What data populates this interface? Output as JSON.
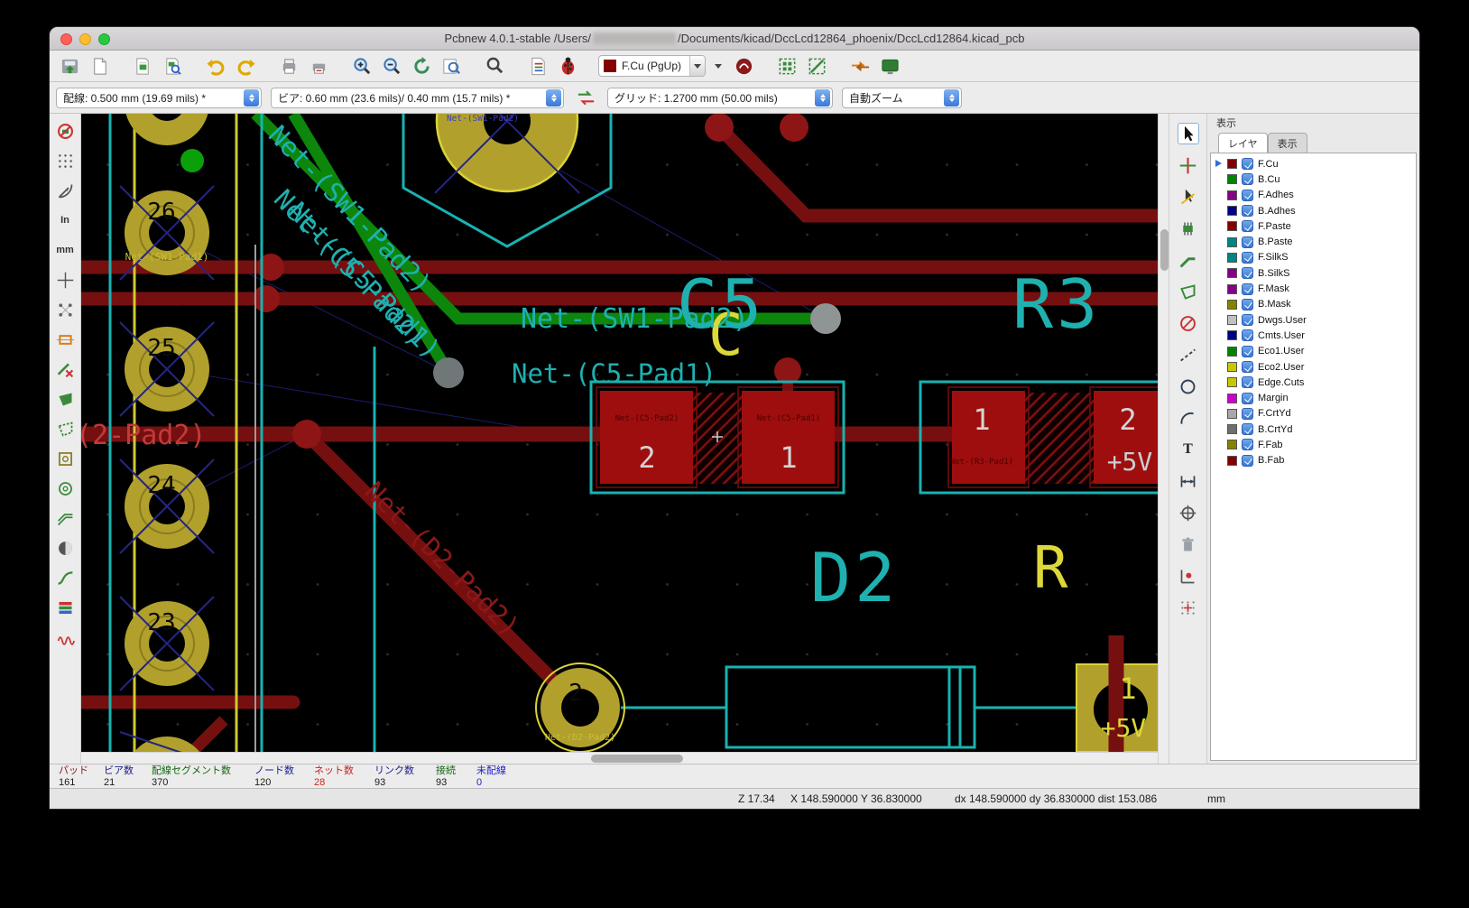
{
  "window": {
    "title_prefix": "Pcbnew 4.0.1-stable /Users/",
    "title_suffix": "/Documents/kicad/DccLcd12864_phoenix/DccLcd12864.kicad_pcb"
  },
  "colors": {
    "copper_front": "#840000",
    "copper_back": "#008400",
    "silkscreen": "#19b2b2",
    "pad_yellow": "#b1a12c",
    "edge_cuts": "#cfca30",
    "accent_blue": "#3b77d8"
  },
  "toolbar_top": {
    "icons": [
      "save-icon",
      "page-settings-icon",
      "footprint-editor-icon",
      "footprint-browser-icon",
      "undo-icon",
      "redo-icon",
      "print-icon",
      "plot-icon",
      "zoom-in-icon",
      "zoom-out-icon",
      "zoom-redraw-icon",
      "zoom-fit-icon",
      "find-icon",
      "netlist-icon",
      "drc-icon",
      "microwave-tools-icon",
      "footprint-mode-icon",
      "track-mode-icon",
      "freeroute-icon",
      "scripting-console-icon"
    ],
    "layer_combo": {
      "value": "F.Cu (PgUp)",
      "color": "#840000"
    }
  },
  "toolbar_params": {
    "track": "配線: 0.500 mm (19.69 mils) *",
    "via": "ビア: 0.60 mm (23.6 mils)/ 0.40 mm (15.7 mils) *",
    "grid": "グリッド: 1.2700 mm (50.00 mils)",
    "zoom": "自動ズーム"
  },
  "toolbar_left": {
    "icons": [
      "drc-toggle-icon",
      "grid-toggle-icon",
      "polar-coords-icon",
      "units-inches-icon",
      "units-mm-icon",
      "cursor-shape-icon",
      "ratsnest-toggle-icon",
      "module-ratsnest-icon",
      "track-autodelete-icon",
      "zone-fill-icon",
      "zone-outline-icon",
      "pad-sketch-icon",
      "via-sketch-icon",
      "track-sketch-icon",
      "high-contrast-icon",
      "route-mode-icon",
      "layers-manager-toggle-icon",
      "microwave-toolbar-icon"
    ],
    "units_in": "In",
    "units_mm": "mm"
  },
  "toolbar_right": {
    "icons": [
      "pointer-icon",
      "highlight-net-icon",
      "local-ratsnest-icon",
      "add-footprint-icon",
      "route-track-icon",
      "add-zone-icon",
      "add-keepout-icon",
      "add-line-icon",
      "add-circle-icon",
      "add-arc-icon",
      "add-text-icon",
      "add-dimension-icon",
      "add-target-icon",
      "delete-icon",
      "drill-origin-icon",
      "grid-origin-icon"
    ],
    "text_tool": "T"
  },
  "layers_panel": {
    "header": "表示",
    "tab_layers": "レイヤ",
    "tab_render": "表示",
    "layers": [
      {
        "name": "F.Cu",
        "color": "#840000",
        "checked": true,
        "active": true
      },
      {
        "name": "B.Cu",
        "color": "#008400",
        "checked": true
      },
      {
        "name": "F.Adhes",
        "color": "#840084",
        "checked": true
      },
      {
        "name": "B.Adhes",
        "color": "#000084",
        "checked": true
      },
      {
        "name": "F.Paste",
        "color": "#840000",
        "checked": true
      },
      {
        "name": "B.Paste",
        "color": "#008484",
        "checked": true
      },
      {
        "name": "F.SilkS",
        "color": "#008484",
        "checked": true
      },
      {
        "name": "B.SilkS",
        "color": "#840084",
        "checked": true
      },
      {
        "name": "F.Mask",
        "color": "#840084",
        "checked": true
      },
      {
        "name": "B.Mask",
        "color": "#848400",
        "checked": true
      },
      {
        "name": "Dwgs.User",
        "color": "#c0c0c0",
        "checked": true
      },
      {
        "name": "Cmts.User",
        "color": "#000084",
        "checked": true
      },
      {
        "name": "Eco1.User",
        "color": "#008400",
        "checked": true
      },
      {
        "name": "Eco2.User",
        "color": "#c8c800",
        "checked": true
      },
      {
        "name": "Edge.Cuts",
        "color": "#c8c800",
        "checked": true
      },
      {
        "name": "Margin",
        "color": "#cc00cc",
        "checked": true
      },
      {
        "name": "F.CrtYd",
        "color": "#a8a8a8",
        "checked": true
      },
      {
        "name": "B.CrtYd",
        "color": "#6e6e6e",
        "checked": true
      },
      {
        "name": "F.Fab",
        "color": "#848400",
        "checked": true
      },
      {
        "name": "B.Fab",
        "color": "#840000",
        "checked": true
      }
    ]
  },
  "status": {
    "stats": [
      {
        "label": "パッド",
        "value": "161",
        "label_color": "#8b1a1a",
        "value_color": "#1a1a1a"
      },
      {
        "label": "ビア数",
        "value": "21",
        "label_color": "#1a1a8b",
        "value_color": "#1a1a1a"
      },
      {
        "label": "配線セグメント数",
        "value": "370",
        "label_color": "#116611",
        "value_color": "#1a1a1a"
      },
      {
        "label": "ノード数",
        "value": "120",
        "label_color": "#1a1a8b",
        "value_color": "#1a1a1a"
      },
      {
        "label": "ネット数",
        "value": "28",
        "label_color": "#cc2222",
        "value_color": "#cc2222"
      },
      {
        "label": "リンク数",
        "value": "93",
        "label_color": "#1a1a8b",
        "value_color": "#1a1a1a"
      },
      {
        "label": "接続",
        "value": "93",
        "label_color": "#116611",
        "value_color": "#1a1a1a"
      },
      {
        "label": "未配線",
        "value": "0",
        "label_color": "#2222cc",
        "value_color": "#2222cc"
      }
    ]
  },
  "coords": {
    "zoom": "Z 17.34",
    "position": "X 148.590000  Y 36.830000",
    "delta": "dx 148.590000  dy 36.830000  dist 153.086",
    "units": "mm"
  },
  "canvas": {
    "texts": {
      "c5": "C5",
      "c_yellow": "C",
      "r3": "R3",
      "d2": "D2",
      "r_yellow": "R",
      "net_sw1_pad2_h": "Net-(SW1-Pad2)",
      "net_c5_pad1_h": "Net-(C5-Pad1)",
      "net_sw1_pad2_diag": "Net-(SW1-Pad2)",
      "net_c5_pad2_diag": "Net-(C5-Pad2)",
      "net_c5_pad1_diag": "Net-(C5-Pad1)",
      "net_d2_pad2_diag": "Net-(D2-Pad2)",
      "net_sw1_pad1_tiny": "Net-(SW1-Pad1)",
      "net_sw1_pad2_tiny": "Net-(SW1-Pad2)",
      "net_d2_pad2_tiny": "Net-(D2-Pad2)",
      "left_partial": "(2-Pad2)",
      "pad26": "26",
      "pad25": "25",
      "pad24": "24",
      "pad23": "23",
      "c5_pad2_num": "2",
      "c5_pad1_num": "1",
      "c5_pad2_net": "Net-(C5-Pad2)",
      "c5_pad1_net": "Net-(C5-Pad1)",
      "r3_pad1_num": "1",
      "r3_pad2_num": "2",
      "r3_pad2_plus": "+5V",
      "r3_pad1_net": "Net-(R3-Pad1)",
      "d2_pad2_num": "2",
      "br_num": "1",
      "br_net": "+5V"
    }
  }
}
